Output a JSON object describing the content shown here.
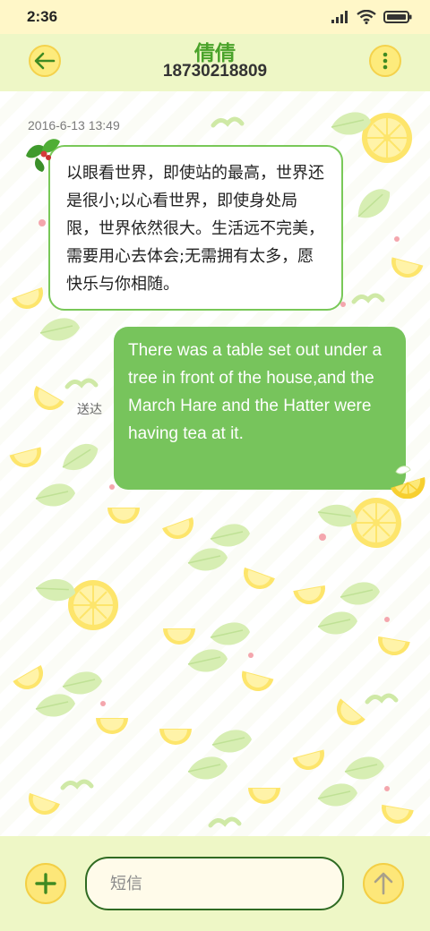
{
  "status_bar": {
    "time": "2:36"
  },
  "header": {
    "contact_name": "倩倩",
    "contact_number": "18730218809"
  },
  "conversation": {
    "timestamp": "2016-6-13 13:49",
    "incoming_message": "以眼看世界，即使站的最高，世界还是很小;以心看世界，即使身处局限，世界依然很大。生活远不完美，需要用心去体会;无需拥有太多，愿快乐与你相随。",
    "sent_status": "送达",
    "outgoing_message": "There was a table set out under a tree in front of the house,and the March Hare and the Hatter were having tea at it."
  },
  "composer": {
    "placeholder": "短信"
  },
  "icons": {
    "back": "arrow-left-icon",
    "menu": "more-vertical-icon",
    "add": "plus-icon",
    "send": "arrow-up-icon"
  },
  "colors": {
    "accent_green": "#77c45c",
    "header_bg": "#eef7c6",
    "button_yellow": "#fde779"
  }
}
